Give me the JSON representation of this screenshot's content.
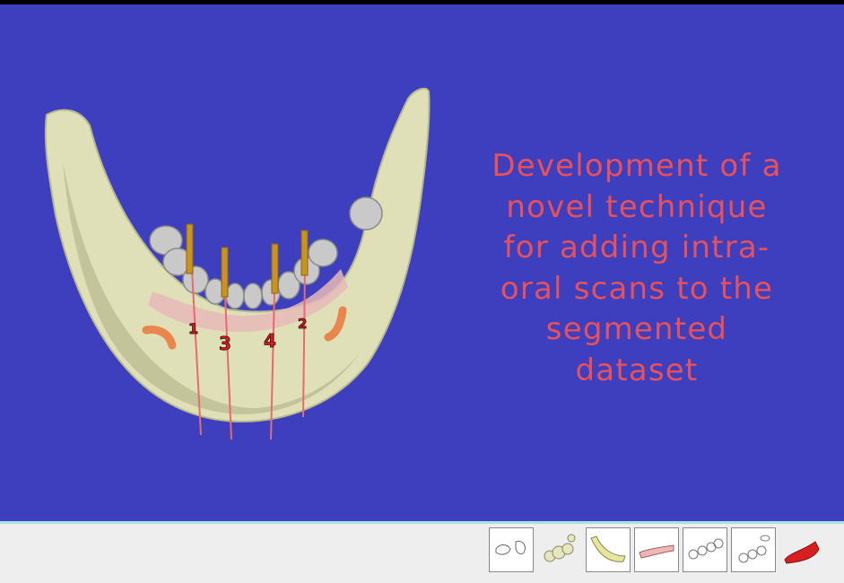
{
  "viewer": {
    "caption": "Development of a\nnovel technique\nfor adding intra-\noral scans to the\nsegmented\ndataset",
    "implant_labels": [
      "1",
      "3",
      "4",
      "2"
    ],
    "background_color": "#3d3fbf",
    "caption_color": "#e8505a"
  },
  "thumbnail_strip": {
    "items": [
      {
        "icon": "skull-sketch-icon"
      },
      {
        "icon": "teeth-cluster-icon"
      },
      {
        "icon": "mandible-yellow-icon"
      },
      {
        "icon": "mandible-pink-icon"
      },
      {
        "icon": "teeth-row-sketch-icon"
      },
      {
        "icon": "teeth-implant-sketch-icon"
      },
      {
        "icon": "red-scan-icon"
      }
    ]
  }
}
